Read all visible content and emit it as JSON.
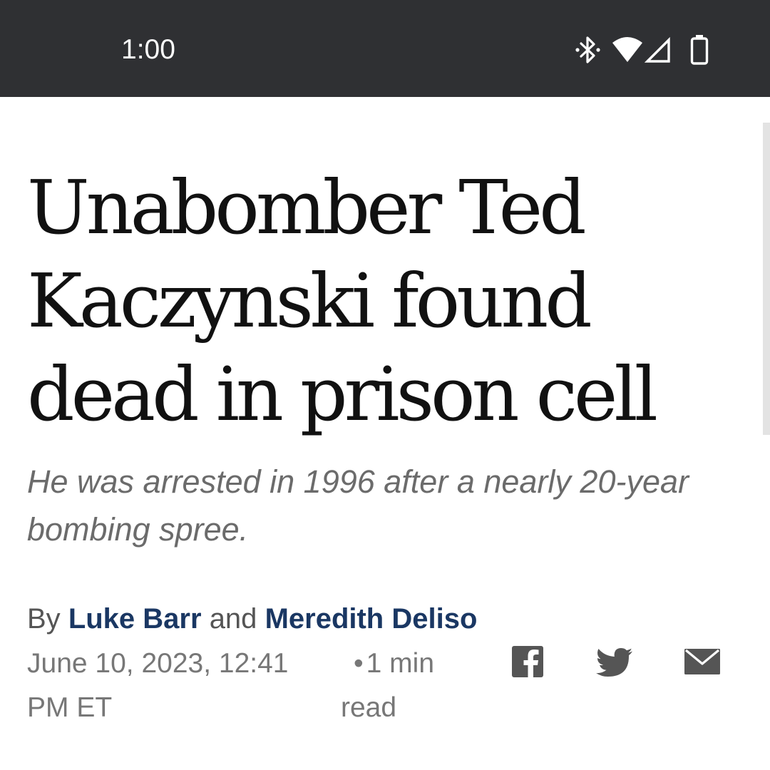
{
  "status_bar": {
    "time": "1:00",
    "icons": [
      "bluetooth-icon",
      "wifi-icon",
      "cellular-signal-icon",
      "battery-icon"
    ]
  },
  "article": {
    "headline": "Unabomber Ted Kaczynski found dead in prison cell",
    "subheadline": "He was arrested in 1996 after a nearly 20-year bombing spree.",
    "byline": {
      "prefix": "By",
      "author_1": "Luke Barr",
      "conjunction": "and",
      "author_2": "Meredith Deliso"
    },
    "date": "June 10, 2023, 12:41 PM ET",
    "read_bullet": "•",
    "read_time": "1 min read"
  },
  "share": {
    "icons": [
      "facebook-icon",
      "twitter-icon",
      "email-icon"
    ]
  },
  "colors": {
    "status_bar_bg": "#2f3033",
    "headline": "#111111",
    "subheadline": "#6b6b6b",
    "author_link": "#1a3763",
    "meta": "#777777",
    "share_icons": "#555555"
  }
}
